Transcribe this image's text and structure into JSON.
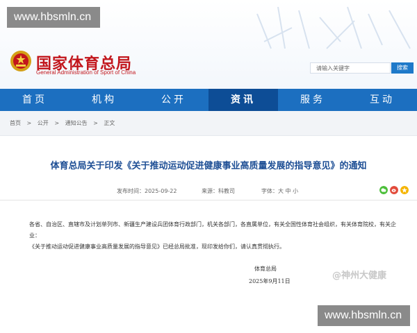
{
  "watermark": {
    "top": "www.hbsmln.cn",
    "bottom": "www.hbsmln.cn"
  },
  "logo": {
    "name_cn": "国家体育总局",
    "name_en": "General Administration of Sport of China"
  },
  "search": {
    "placeholder": "请输入关键字",
    "button_label": "搜索"
  },
  "nav": {
    "items": [
      "首页",
      "机构",
      "公开",
      "资讯",
      "服务",
      "互动"
    ],
    "active": "资讯"
  },
  "breadcrumb": {
    "items": [
      "首页",
      ">",
      "公开",
      ">",
      "通知公告",
      ">",
      "正文"
    ]
  },
  "article": {
    "title": "体育总局关于印发《关于推动运动促进健康事业高质量发展的指导意见》的通知",
    "publish_date": "发布时间：2025-09-22",
    "source": "来源：科教司",
    "font_size_label": "字体：大 中 小",
    "paragraph_1": "各省、自治区、直辖市及计划单列市、新疆生产建设兵团体育行政部门，机关各部门，各直属单位，有关全国性体育社会组织，有关体育院校，有关企业：",
    "paragraph_2": "《关于推动运动促进健康事业高质量发展的指导意见》已经总局批准，现印发给你们，请认真贯彻执行。",
    "signature_org": "体育总局",
    "signature_date": "2025年9月11日"
  },
  "share_icons": [
    "wechat-icon",
    "weibo-icon",
    "qzone-icon"
  ],
  "corner_watermark": "@神州大健康",
  "colors": {
    "nav_bg": "#1c6fc0",
    "nav_active": "#0d4d96",
    "brand_red": "#c2161c",
    "title_blue": "#1e4f95"
  }
}
